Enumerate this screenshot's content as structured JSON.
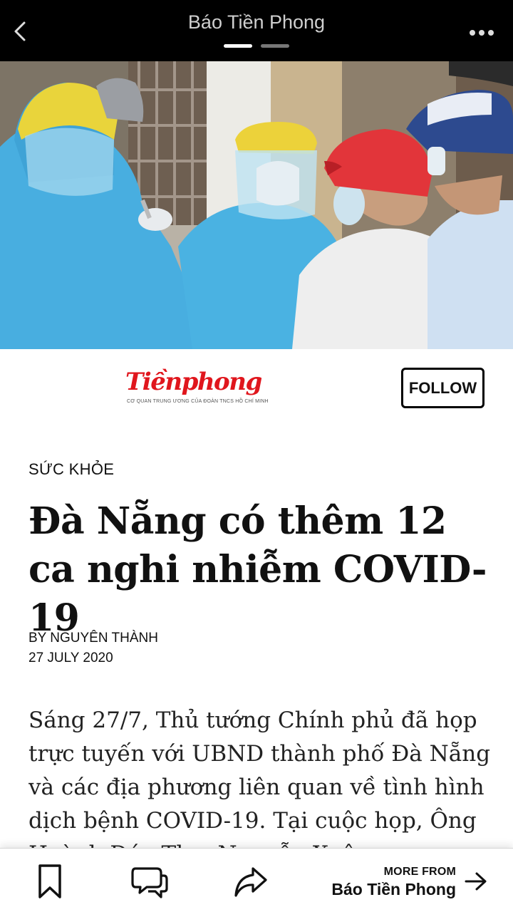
{
  "app_bar": {
    "title": "Báo Tiền Phong",
    "back_icon": "chevron-left-icon",
    "menu_icon": "more-horizontal-icon",
    "pager": {
      "pages": 2,
      "active": 1
    }
  },
  "publisher": {
    "logo_text": "Tiềnphong",
    "logo_tagline": "CƠ QUAN TRUNG ƯƠNG CỦA ĐOÀN TNCS HỒ CHÍ MINH",
    "brand_color": "#e0161d",
    "follow_label": "FOLLOW"
  },
  "article": {
    "category": "SỨC KHỎE",
    "headline": "Đà Nẵng có thêm 12 ca nghi nhiễm COVID-19",
    "byline": "BY NGUYÊN THÀNH",
    "date": "27 JULY 2020",
    "body": "Sáng 27/7, Thủ tướng Chính phủ đã họp trực tuyến với UBND thành phố Đà Nẵng và các địa phương liên quan về tình hình dịch bệnh COVID-19. Tại cuộc họp, Ông Huỳnh Đức Thơ, Nguyễn Xuân..."
  },
  "bottom_bar": {
    "bookmark_icon": "bookmark-icon",
    "comment_icon": "comment-icon",
    "share_icon": "share-icon",
    "more_from_label": "MORE FROM",
    "more_from_source": "Báo Tiền Phong",
    "arrow_icon": "arrow-right-icon"
  }
}
